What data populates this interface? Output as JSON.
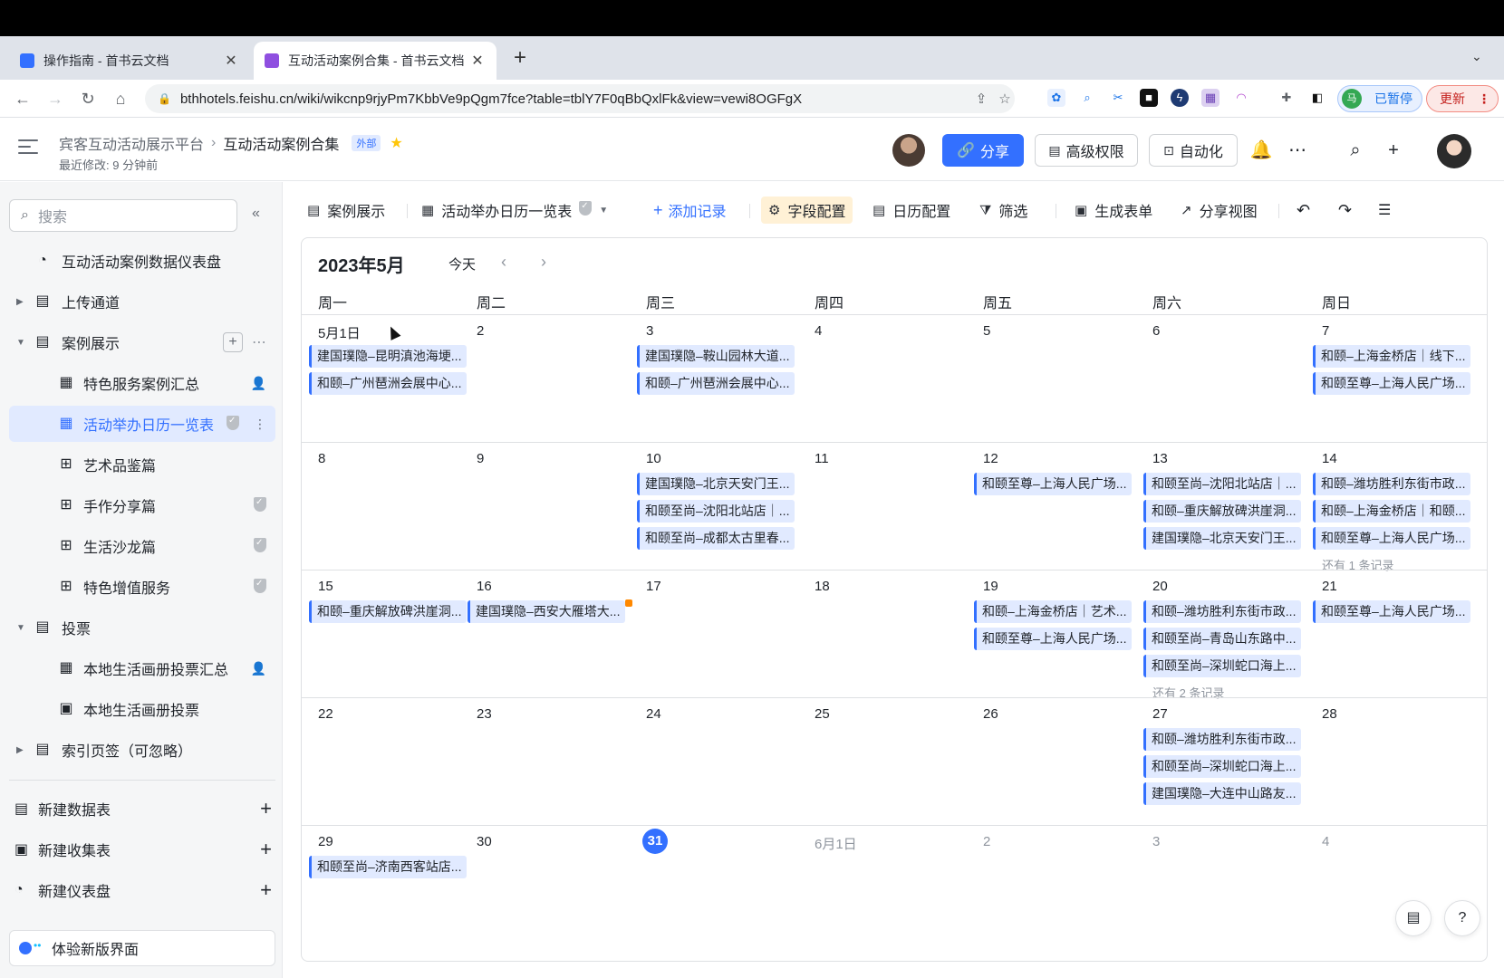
{
  "browser": {
    "tabs": [
      {
        "title": "操作指南 - 首书云文档",
        "color": "#3370ff"
      },
      {
        "title": "互动活动案例合集 - 首书云文档",
        "color": "#8f4fe0"
      }
    ],
    "url": "bthhotels.feishu.cn/wiki/wikcnp9rjyPm7KbbVe9pQgm7fce?table=tblY7F0qBbQxlFk&view=vewi8OGFgX",
    "paused_label": "已暂停",
    "profile_initial": "马",
    "update_label": "更新"
  },
  "header": {
    "breadcrumb_parent": "宾客互动活动展示平台",
    "breadcrumb_current": "互动活动案例合集",
    "external_tag": "外部",
    "last_modified": "最近修改: 9 分钟前",
    "share_label": "分享",
    "permissions_label": "高级权限",
    "automation_label": "自动化"
  },
  "sidebar": {
    "search_placeholder": "搜索",
    "items": [
      {
        "label": "互动活动案例数据仪表盘"
      },
      {
        "label": "上传通道"
      },
      {
        "label": "案例展示"
      },
      {
        "label": "特色服务案例汇总"
      },
      {
        "label": "活动举办日历一览表"
      },
      {
        "label": "艺术品鉴篇"
      },
      {
        "label": "手作分享篇"
      },
      {
        "label": "生活沙龙篇"
      },
      {
        "label": "特色增值服务"
      },
      {
        "label": "投票"
      },
      {
        "label": "本地生活画册投票汇总"
      },
      {
        "label": "本地生活画册投票"
      },
      {
        "label": "索引页签（可忽略）"
      }
    ],
    "create": [
      {
        "label": "新建数据表"
      },
      {
        "label": "新建收集表"
      },
      {
        "label": "新建仪表盘"
      }
    ],
    "new_ui_label": "体验新版界面"
  },
  "toolbar": {
    "table_name": "案例展示",
    "view_name": "活动举办日历一览表",
    "add_record": "添加记录",
    "field_config": "字段配置",
    "calendar_config": "日历配置",
    "filter": "筛选",
    "gen_form": "生成表单",
    "share_view": "分享视图"
  },
  "calendar": {
    "month_title": "2023年5月",
    "today_label": "今天",
    "weekdays": [
      "周一",
      "周二",
      "周三",
      "周四",
      "周五",
      "周六",
      "周日"
    ],
    "weeks": [
      {
        "days": [
          {
            "num": "5月1日",
            "events": [
              "建国璞隐–昆明滇池海埂...",
              "和颐–广州琶洲会展中心..."
            ]
          },
          {
            "num": "2",
            "events": []
          },
          {
            "num": "3",
            "events": [
              "建国璞隐–鞍山园林大道...",
              "和颐–广州琶洲会展中心..."
            ]
          },
          {
            "num": "4",
            "events": []
          },
          {
            "num": "5",
            "events": []
          },
          {
            "num": "6",
            "events": []
          },
          {
            "num": "7",
            "events": [
              "和颐–上海金桥店｜线下...",
              "和颐至尊–上海人民广场..."
            ]
          }
        ]
      },
      {
        "days": [
          {
            "num": "8",
            "events": []
          },
          {
            "num": "9",
            "events": []
          },
          {
            "num": "10",
            "events": [
              "建国璞隐–北京天安门王...",
              "和颐至尚–沈阳北站店｜...",
              "和颐至尚–成都太古里春..."
            ]
          },
          {
            "num": "11",
            "events": []
          },
          {
            "num": "12",
            "events": [
              "和颐至尊–上海人民广场..."
            ]
          },
          {
            "num": "13",
            "events": [
              "和颐至尚–沈阳北站店｜...",
              "和颐–重庆解放碑洪崖洞...",
              "建国璞隐–北京天安门王..."
            ]
          },
          {
            "num": "14",
            "events": [
              "和颐–潍坊胜利东街市政...",
              "和颐–上海金桥店｜和颐...",
              "和颐至尊–上海人民广场..."
            ],
            "more": "还有 1 条记录"
          }
        ]
      },
      {
        "days": [
          {
            "num": "15",
            "events": [
              "和颐–重庆解放碑洪崖洞..."
            ]
          },
          {
            "num": "16",
            "events": [
              "建国璞隐–西安大雁塔大..."
            ]
          },
          {
            "num": "17",
            "events": []
          },
          {
            "num": "18",
            "events": []
          },
          {
            "num": "19",
            "events": [
              "和颐–上海金桥店｜艺术...",
              "和颐至尊–上海人民广场..."
            ]
          },
          {
            "num": "20",
            "events": [
              "和颐–潍坊胜利东街市政...",
              "和颐至尚–青岛山东路中...",
              "和颐至尚–深圳蛇口海上..."
            ],
            "more": "还有 2 条记录"
          },
          {
            "num": "21",
            "events": [
              "和颐至尊–上海人民广场..."
            ]
          }
        ]
      },
      {
        "days": [
          {
            "num": "22",
            "events": []
          },
          {
            "num": "23",
            "events": []
          },
          {
            "num": "24",
            "events": []
          },
          {
            "num": "25",
            "events": []
          },
          {
            "num": "26",
            "events": []
          },
          {
            "num": "27",
            "events": [
              "和颐–潍坊胜利东街市政...",
              "和颐至尚–深圳蛇口海上...",
              "建国璞隐–大连中山路友..."
            ]
          },
          {
            "num": "28",
            "events": []
          }
        ]
      },
      {
        "days": [
          {
            "num": "29",
            "events": [
              "和颐至尚–济南西客站店..."
            ]
          },
          {
            "num": "30",
            "events": []
          },
          {
            "num": "31",
            "events": [],
            "today": true
          },
          {
            "num": "6月1日",
            "events": [],
            "muted": true
          },
          {
            "num": "2",
            "events": [],
            "muted": true
          },
          {
            "num": "3",
            "events": [],
            "muted": true
          },
          {
            "num": "4",
            "events": [],
            "muted": true
          }
        ]
      }
    ]
  },
  "colors": {
    "accent": "#3370ff",
    "event_bg": "#e1eaff",
    "highlight": "#fff1d6"
  }
}
